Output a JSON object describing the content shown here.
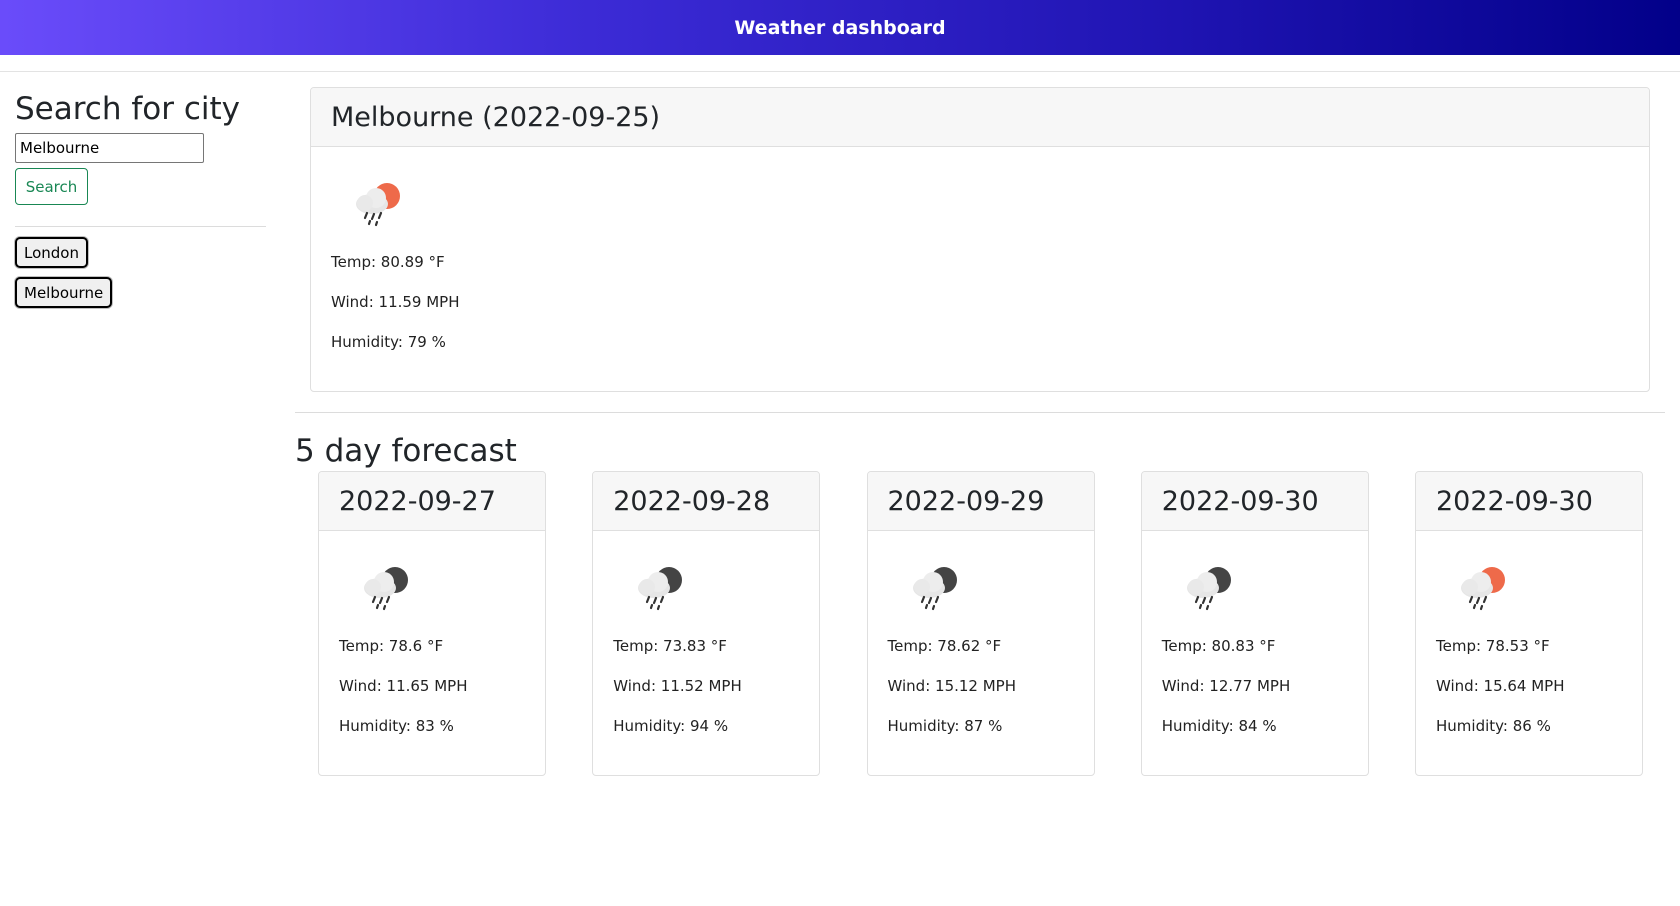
{
  "header": {
    "title": "Weather dashboard"
  },
  "sidebar": {
    "heading": "Search for city",
    "search_value": "Melbourne",
    "search_button": "Search",
    "history": [
      "London",
      "Melbourne"
    ]
  },
  "current": {
    "title": "Melbourne (2022-09-25)",
    "icon": "rain-cloud-sun-icon",
    "temp": "Temp: 80.89 °F",
    "wind": "Wind: 11.59 MPH",
    "humidity": "Humidity: 79 %"
  },
  "forecast": {
    "title": "5 day forecast",
    "days": [
      {
        "date": "2022-09-27",
        "icon": "rain-cloud-moon-icon",
        "temp": "Temp: 78.6 °F",
        "wind": "Wind: 11.65 MPH",
        "humidity": "Humidity: 83 %"
      },
      {
        "date": "2022-09-28",
        "icon": "rain-cloud-moon-icon",
        "temp": "Temp: 73.83 °F",
        "wind": "Wind: 11.52 MPH",
        "humidity": "Humidity: 94 %"
      },
      {
        "date": "2022-09-29",
        "icon": "rain-cloud-moon-icon",
        "temp": "Temp: 78.62 °F",
        "wind": "Wind: 15.12 MPH",
        "humidity": "Humidity: 87 %"
      },
      {
        "date": "2022-09-30",
        "icon": "rain-cloud-moon-icon",
        "temp": "Temp: 80.83 °F",
        "wind": "Wind: 12.77 MPH",
        "humidity": "Humidity: 84 %"
      },
      {
        "date": "2022-09-30",
        "icon": "rain-cloud-sun-icon",
        "temp": "Temp: 78.53 °F",
        "wind": "Wind: 15.64 MPH",
        "humidity": "Humidity: 86 %"
      }
    ]
  },
  "colors": {
    "header_start": "#6a4cfa",
    "header_end": "#020089",
    "search_button": "#198754",
    "sun": "#ee6a4a",
    "moon": "#444444"
  }
}
